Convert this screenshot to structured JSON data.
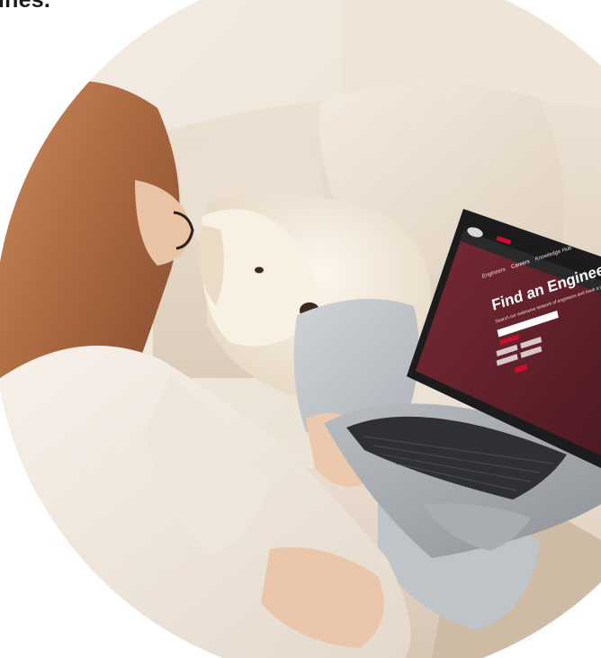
{
  "heading": {
    "fragment": "ines."
  },
  "laptop_screen": {
    "nav_items": [
      "Engineers",
      "Careers",
      "Knowledge Hub"
    ],
    "hero_title": "Find an Engineer",
    "hero_text": "Search our extensive network of engineers and book a technician in your area"
  },
  "colors": {
    "brand_red": "#c8102e",
    "hero_maroon": "#6a2530",
    "background": "#ffffff"
  }
}
